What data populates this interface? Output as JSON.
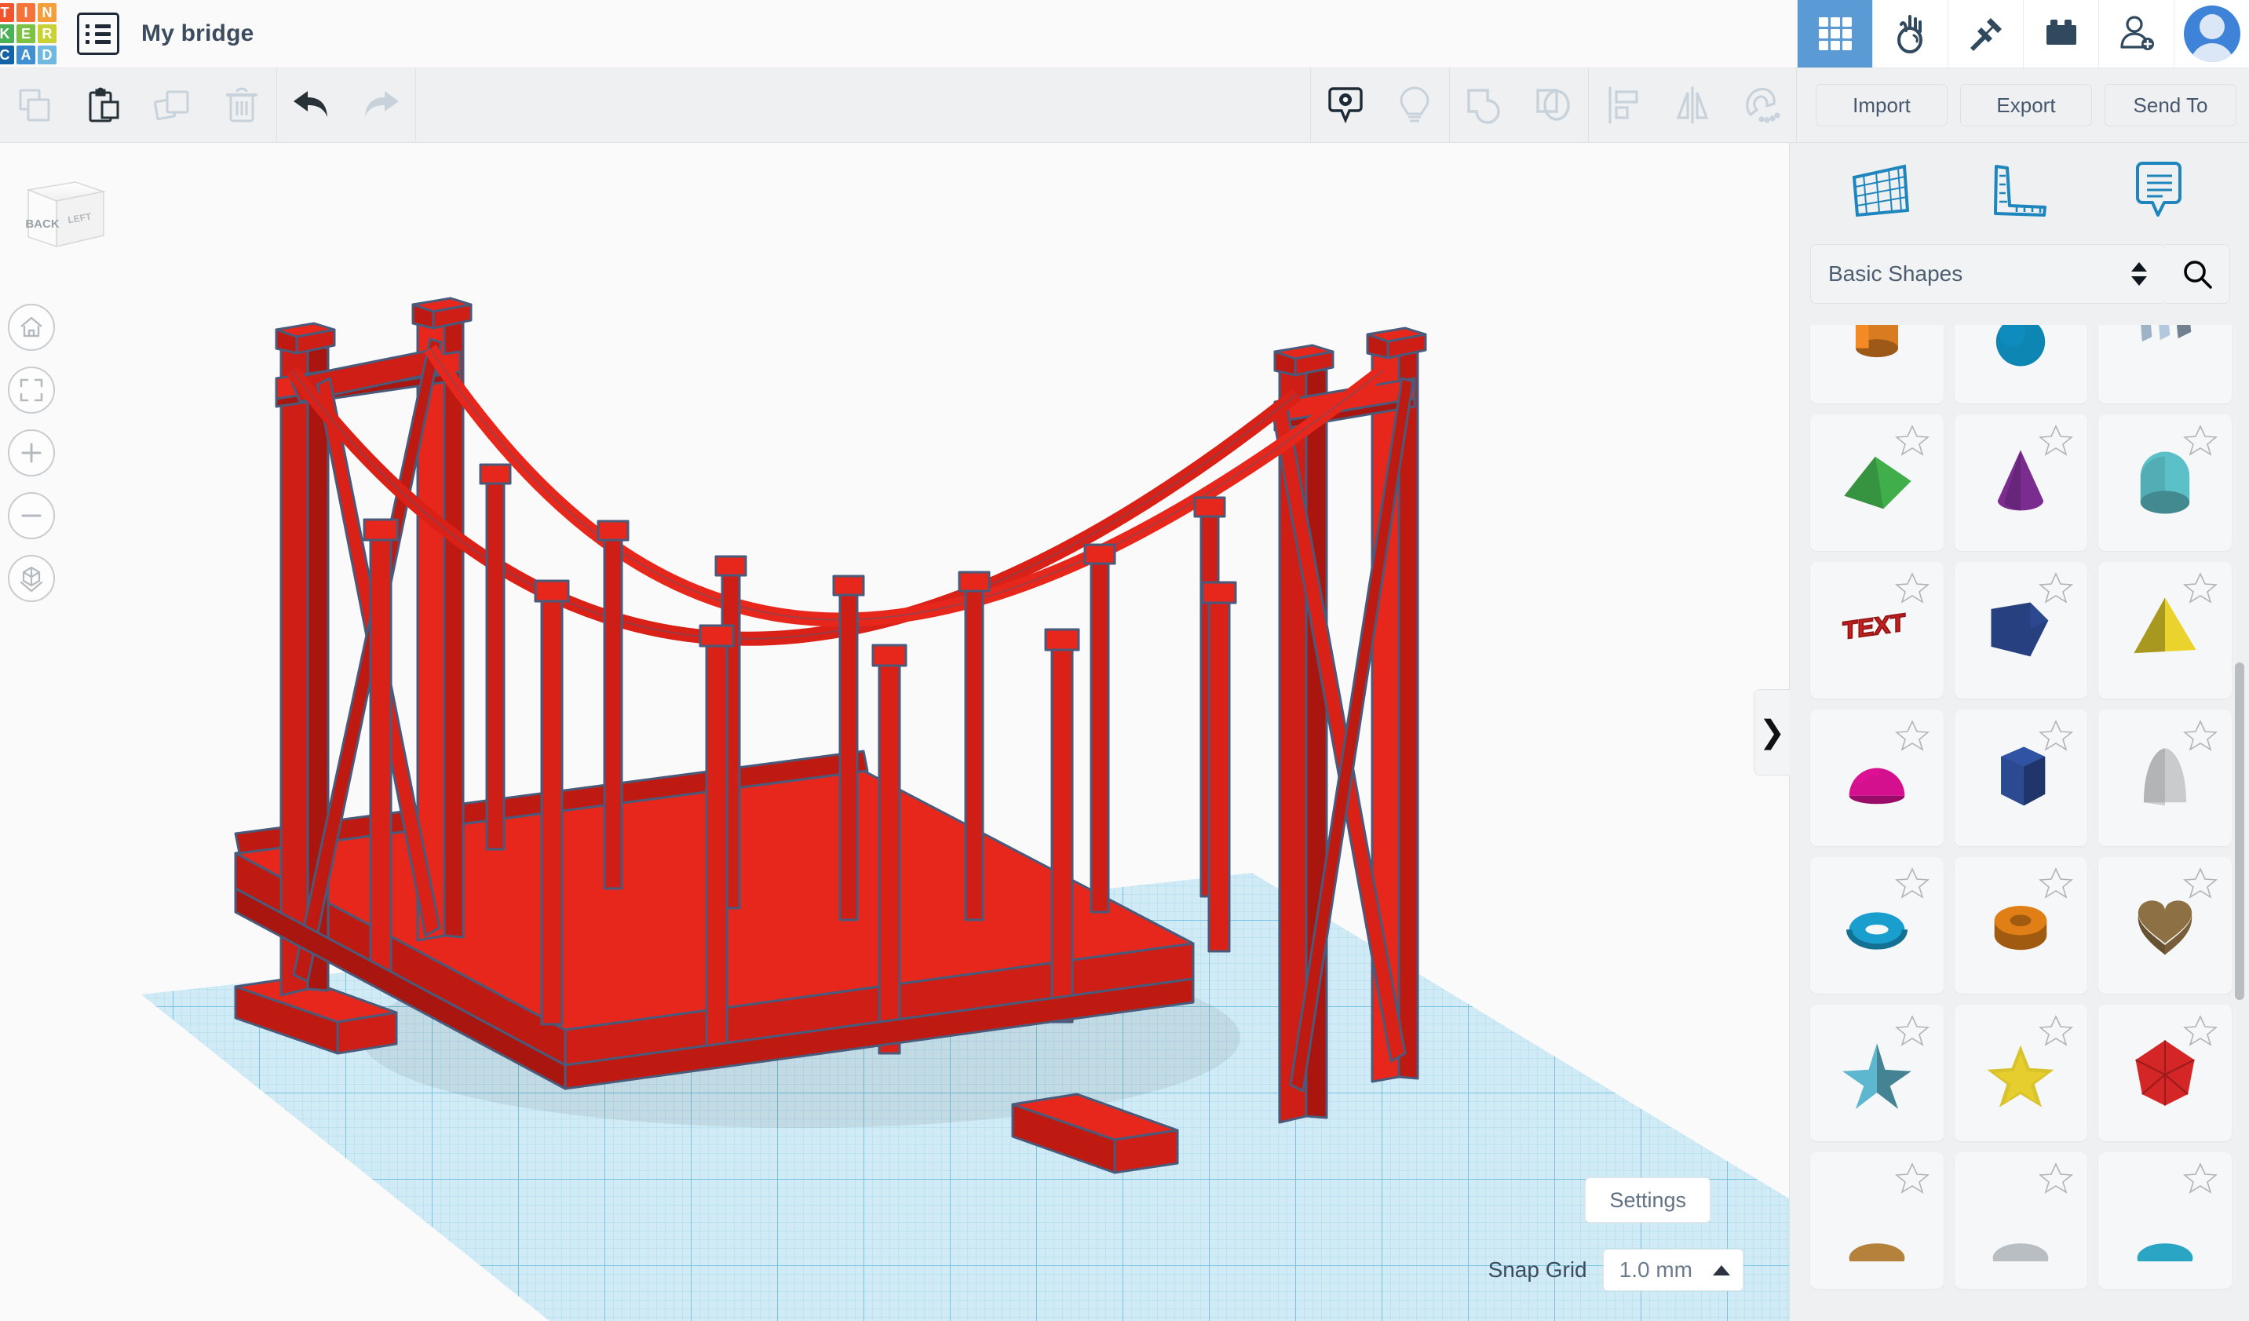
{
  "app": {
    "brand_letters": [
      {
        "ch": "T",
        "color": "#f2542d"
      },
      {
        "ch": "I",
        "color": "#f4743b"
      },
      {
        "ch": "N",
        "color": "#f59f3c"
      },
      {
        "ch": "K",
        "color": "#4bb156"
      },
      {
        "ch": "E",
        "color": "#7dc242"
      },
      {
        "ch": "R",
        "color": "#c9d135"
      },
      {
        "ch": "C",
        "color": "#1263a8"
      },
      {
        "ch": "A",
        "color": "#3f8fd2"
      },
      {
        "ch": "D",
        "color": "#6fb8e0"
      }
    ],
    "document_title": "My bridge",
    "doc_icon": "list-document-icon"
  },
  "header": {
    "apps": [
      {
        "name": "3d-design-icon",
        "label": "3D Design",
        "active": true
      },
      {
        "name": "codeblocks-icon",
        "label": "Codeblocks",
        "active": false
      },
      {
        "name": "minecraft-pickaxe-icon",
        "label": "Minecraft",
        "active": false
      },
      {
        "name": "lego-brick-icon",
        "label": "Bricks",
        "active": false
      },
      {
        "name": "add-person-icon",
        "label": "Invite",
        "active": false
      }
    ],
    "avatar_label": "Account"
  },
  "toolbar": {
    "edit_tools": [
      {
        "name": "copy-icon",
        "label": "Copy",
        "enabled": false
      },
      {
        "name": "paste-icon",
        "label": "Paste",
        "enabled": true
      },
      {
        "name": "duplicate-icon",
        "label": "Duplicate",
        "enabled": false
      },
      {
        "name": "delete-icon",
        "label": "Delete",
        "enabled": false
      }
    ],
    "history_tools": [
      {
        "name": "undo-icon",
        "label": "Undo",
        "enabled": true
      },
      {
        "name": "redo-icon",
        "label": "Redo",
        "enabled": false
      }
    ],
    "view_tools": [
      {
        "name": "show-hide-icon",
        "label": "Show all",
        "enabled": true
      },
      {
        "name": "lightbulb-icon",
        "label": "Hide",
        "enabled": false
      }
    ],
    "group_tools": [
      {
        "name": "group-icon",
        "label": "Group",
        "enabled": false
      },
      {
        "name": "ungroup-icon",
        "label": "Ungroup",
        "enabled": false
      }
    ],
    "arrange_tools": [
      {
        "name": "align-icon",
        "label": "Align",
        "enabled": false
      },
      {
        "name": "mirror-icon",
        "label": "Mirror",
        "enabled": false
      },
      {
        "name": "magnet-snap-icon",
        "label": "Snap",
        "enabled": false
      }
    ],
    "import_label": "Import",
    "export_label": "Export",
    "send_to_label": "Send To"
  },
  "canvas": {
    "view_cube": {
      "front_face": "BACK",
      "side_face": "LEFT"
    },
    "nav_buttons": [
      {
        "name": "home-view-icon",
        "label": "Home view"
      },
      {
        "name": "fit-to-view-icon",
        "label": "Fit all in view"
      },
      {
        "name": "zoom-in-icon",
        "label": "Zoom in"
      },
      {
        "name": "zoom-out-icon",
        "label": "Zoom out"
      },
      {
        "name": "ortho-perspective-icon",
        "label": "Switch to orthographic/perspective view"
      }
    ],
    "model": {
      "name": "suspension-bridge-model",
      "color": "#e8271c",
      "edge_color": "#4a5a7a",
      "description": "Red suspension bridge with two towers, draped cables, vertical hangers and a flat deck"
    },
    "workplane": {
      "color": "#bce3f2",
      "grid_color": "#6bbcd9"
    }
  },
  "statusbar": {
    "settings_label": "Settings",
    "snap_grid_label": "Snap Grid",
    "snap_grid_value": "1.0 mm",
    "snap_grid_caret": "caret-up-icon"
  },
  "right_panel": {
    "tabs": [
      {
        "name": "workplane-tab-icon",
        "label": "Workplane"
      },
      {
        "name": "ruler-tab-icon",
        "label": "Ruler"
      },
      {
        "name": "notes-tab-icon",
        "label": "Note"
      }
    ],
    "category_value": "Basic Shapes",
    "search_icon": "search-icon",
    "collapse_icon": "chevron-right-icon",
    "shapes": [
      {
        "name": "cylinder-shape",
        "label": "Cylinder",
        "color": "#d97b20",
        "kind": "cylinder",
        "star": false
      },
      {
        "name": "sphere-shape",
        "label": "Sphere",
        "color": "#0d86b4",
        "kind": "sphere",
        "star": false
      },
      {
        "name": "paraboloid-shape",
        "label": "Paraboloid",
        "color": "#9fb3c7",
        "kind": "fins",
        "star": false
      },
      {
        "name": "wedge-shape",
        "label": "Wedge",
        "color": "#3fae4b",
        "kind": "wedge",
        "star": true
      },
      {
        "name": "cone-shape",
        "label": "Cone",
        "color": "#7a2d8f",
        "kind": "cone",
        "star": true
      },
      {
        "name": "roof-shape",
        "label": "Round Roof",
        "color": "#5cc0c8",
        "kind": "roof",
        "star": true
      },
      {
        "name": "text-shape",
        "label": "Text",
        "color": "#cf2020",
        "kind": "text",
        "star": true
      },
      {
        "name": "box-shape",
        "label": "Box",
        "color": "#27407f",
        "kind": "box",
        "star": true
      },
      {
        "name": "pyramid-shape",
        "label": "Pyramid",
        "color": "#ead32d",
        "kind": "pyramid",
        "star": true
      },
      {
        "name": "half-sphere-shape",
        "label": "Half Sphere",
        "color": "#d4108f",
        "kind": "dome",
        "star": true
      },
      {
        "name": "polygon-shape",
        "label": "Polygon",
        "color": "#2c4a92",
        "kind": "hexprism",
        "star": true
      },
      {
        "name": "cone-grey-shape",
        "label": "Paraboloid",
        "color": "#c9cbcd",
        "kind": "bullet",
        "star": true
      },
      {
        "name": "torus-shape",
        "label": "Torus",
        "color": "#1a9ecd",
        "kind": "torus",
        "star": true
      },
      {
        "name": "tube-shape",
        "label": "Tube",
        "color": "#e07f16",
        "kind": "tube",
        "star": true
      },
      {
        "name": "heart-shape",
        "label": "Heart",
        "color": "#8d7043",
        "kind": "heart",
        "star": true
      },
      {
        "name": "star-3d-shape",
        "label": "Star",
        "color": "#56a8bd",
        "kind": "star3d",
        "star": true
      },
      {
        "name": "star-flat-shape",
        "label": "Star",
        "color": "#d9c32c",
        "kind": "starflat",
        "star": true
      },
      {
        "name": "polyhedron-shape",
        "label": "Polyhedron",
        "color": "#d42626",
        "kind": "poly",
        "star": true
      },
      {
        "name": "extrusion-shape",
        "label": "Extrusion",
        "color": "#b5823c",
        "kind": "partial",
        "star": true
      },
      {
        "name": "cylinder-grey-shape",
        "label": "Cylinder",
        "color": "#b9bec2",
        "kind": "partial",
        "star": true
      },
      {
        "name": "teal-shape",
        "label": "Shape",
        "color": "#2ba5c4",
        "kind": "partial",
        "star": true
      }
    ]
  }
}
